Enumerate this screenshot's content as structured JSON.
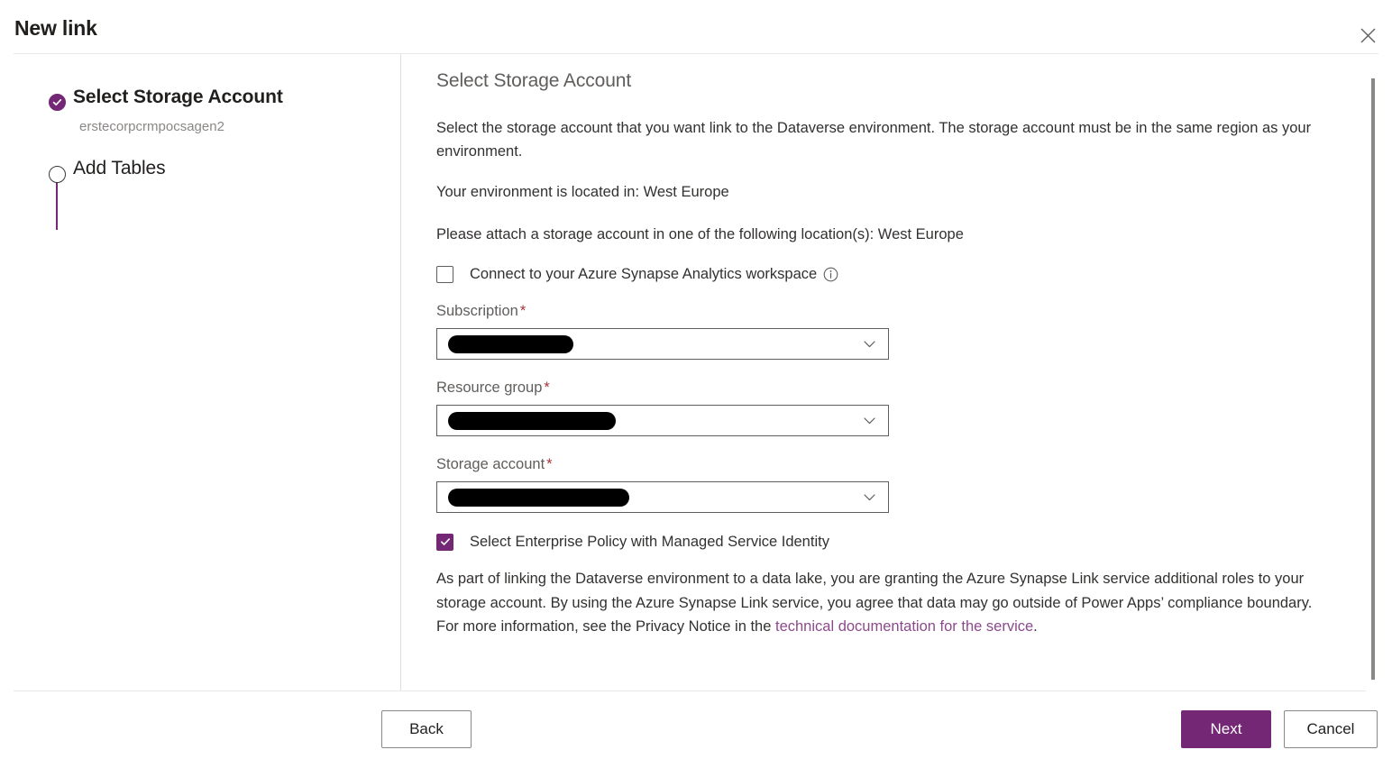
{
  "dialog": {
    "title": "New link",
    "close_label": "Close"
  },
  "steps": [
    {
      "label": "Select Storage Account",
      "sub": "erstecorpcrmpocsagen2",
      "state": "completed"
    },
    {
      "label": "Add Tables",
      "sub": "",
      "state": "pending"
    }
  ],
  "main": {
    "heading": "Select Storage Account",
    "intro": "Select the storage account that you want link to the Dataverse environment. The storage account must be in the same region as your environment.",
    "environment_location": "Your environment is located in: West Europe",
    "attach_locations": "Please attach a storage account in one of the following location(s): West Europe",
    "synapse_checkbox": {
      "label": "Connect to your Azure Synapse Analytics workspace",
      "checked": false,
      "info_tooltip": "info-icon"
    },
    "fields": [
      {
        "label": "Subscription",
        "required": "*",
        "value": "",
        "redacted": true
      },
      {
        "label": "Resource group",
        "required": "*",
        "value": "",
        "redacted": true
      },
      {
        "label": "Storage account",
        "required": "*",
        "value": "",
        "redacted": true
      }
    ],
    "enterprise_policy_checkbox": {
      "label": "Select Enterprise Policy with Managed Service Identity",
      "checked": true
    },
    "legal": {
      "text_before": "As part of linking the Dataverse environment to a data lake, you are granting the Azure Synapse Link service additional roles to your storage account. By using the Azure Synapse Link service, you agree that data may go outside of Power Apps’ compliance boundary. For more information, see the Privacy Notice in the ",
      "link_text": "technical documentation for the service",
      "text_after": "."
    }
  },
  "footer": {
    "back_label": "Back",
    "next_label": "Next",
    "cancel_label": "Cancel"
  },
  "colors": {
    "accent_purple": "#742774",
    "link_purple": "#8b4a8b",
    "required_red": "#a4373a",
    "muted_text": "#605e5c"
  }
}
